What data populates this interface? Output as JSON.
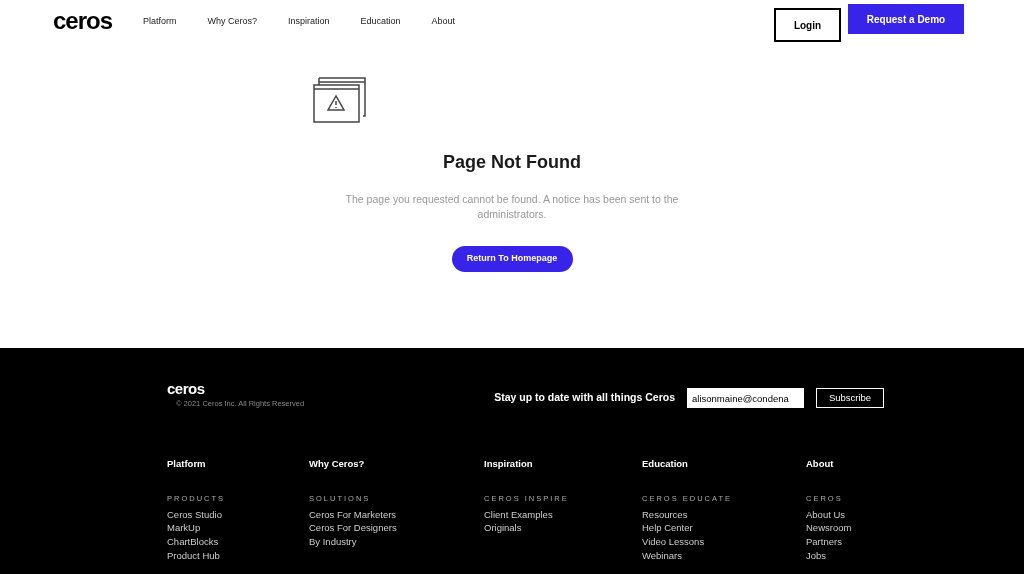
{
  "header": {
    "logo": "ceros",
    "nav": [
      "Platform",
      "Why Ceros?",
      "Inspiration",
      "Education",
      "About"
    ],
    "login": "Login",
    "demo": "Request a Demo"
  },
  "error": {
    "title": "Page Not Found",
    "message": "The page you requested cannot be found. A notice has been sent to the administrators.",
    "button": "Return To Homepage"
  },
  "footer": {
    "logo": "ceros",
    "copyright": "© 2021 Ceros Inc. All Rights Reserved",
    "newsletter_label": "Stay up to date with all things Ceros",
    "email_value": "alisonmaine@condena",
    "subscribe": "Subscribe",
    "columns": [
      {
        "title": "Platform",
        "section": "PRODUCTS",
        "links": [
          "Ceros Studio",
          "MarkUp",
          "ChartBlocks",
          "Product Hub"
        ]
      },
      {
        "title": "Why Ceros?",
        "section": "SOLUTIONS",
        "links": [
          "Ceros For Marketers",
          "Ceros For Designers",
          "By Industry"
        ]
      },
      {
        "title": "Inspiration",
        "section": "CEROS INSPIRE",
        "links": [
          "Client Examples",
          "Originals"
        ]
      },
      {
        "title": "Education",
        "section": "CEROS EDUCATE",
        "links": [
          "Resources",
          "Help Center",
          "Video Lessons",
          "Webinars"
        ]
      },
      {
        "title": "About",
        "section": "CEROS",
        "links": [
          "About Us",
          "Newsroom",
          "Partners",
          "Jobs"
        ]
      }
    ]
  }
}
